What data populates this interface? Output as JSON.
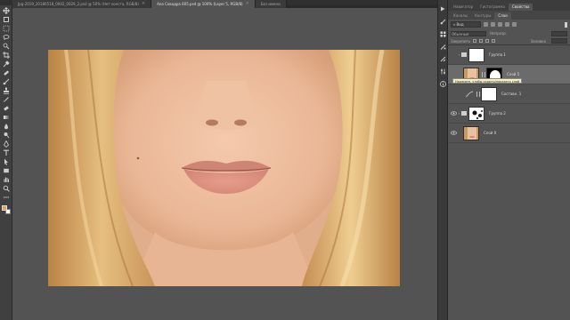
{
  "tabs": [
    {
      "label": "Jpg-2019_20180518_0002_0029_2.psd @ 50% (Нет холста, RGB/8)",
      "active": false
    },
    {
      "label": "Ana Сквадра 605.psd @ 100% (Layer 5, RGB/8)",
      "active": true
    },
    {
      "label": "Без имени",
      "active": false
    }
  ],
  "panel": {
    "top_tabs": [
      "Навигатор",
      "Гистограмма",
      "Свойства"
    ],
    "active_top_tab": "Свойства",
    "sub_tabs": [
      "Каналы",
      "Контуры",
      "Слои"
    ],
    "active_sub_tab": "Слои",
    "filter_label": "Вид",
    "blend_label": "Обычные",
    "opacity_label": "Непрозр.",
    "lock_label": "Закрепить",
    "fill_label": "Заливка"
  },
  "layers": [
    {
      "name": "Группа 1",
      "visible": false,
      "kind": "group"
    },
    {
      "name": "Слой 5",
      "visible": false,
      "kind": "masked",
      "selected": true
    },
    {
      "name": "Составн. 1",
      "visible": false,
      "kind": "adjustment"
    },
    {
      "name": "Группа 2",
      "visible": true,
      "kind": "group"
    },
    {
      "name": "Слой 0",
      "visible": true,
      "kind": "photo"
    }
  ],
  "tooltip": "Нажмите, чтобы скрыть/показать слой",
  "icons": {
    "tools": [
      "move-tool-icon",
      "artboard-tool-icon",
      "marquee-tool-icon",
      "lasso-tool-icon",
      "quick-selection-tool-icon",
      "crop-tool-icon",
      "eyedropper-tool-icon",
      "healing-brush-tool-icon",
      "brush-tool-icon",
      "clone-stamp-tool-icon",
      "history-brush-tool-icon",
      "eraser-tool-icon",
      "gradient-tool-icon",
      "blur-tool-icon",
      "dodge-tool-icon",
      "pen-tool-icon",
      "type-tool-icon",
      "path-selection-tool-icon",
      "rectangle-tool-icon",
      "hand-tool-icon",
      "zoom-tool-icon",
      "more-tools-icon"
    ],
    "panel_icons": [
      "play-icon",
      "brush-settings-icon",
      "swatches-icon",
      "adjustments-icon",
      "styles-icon",
      "properties-icon",
      "info-icon"
    ]
  },
  "colors": {
    "foreground": "#e7a05a",
    "background": "#ffffff",
    "canvas_bg": "#535353",
    "panel_bg": "#535353"
  }
}
